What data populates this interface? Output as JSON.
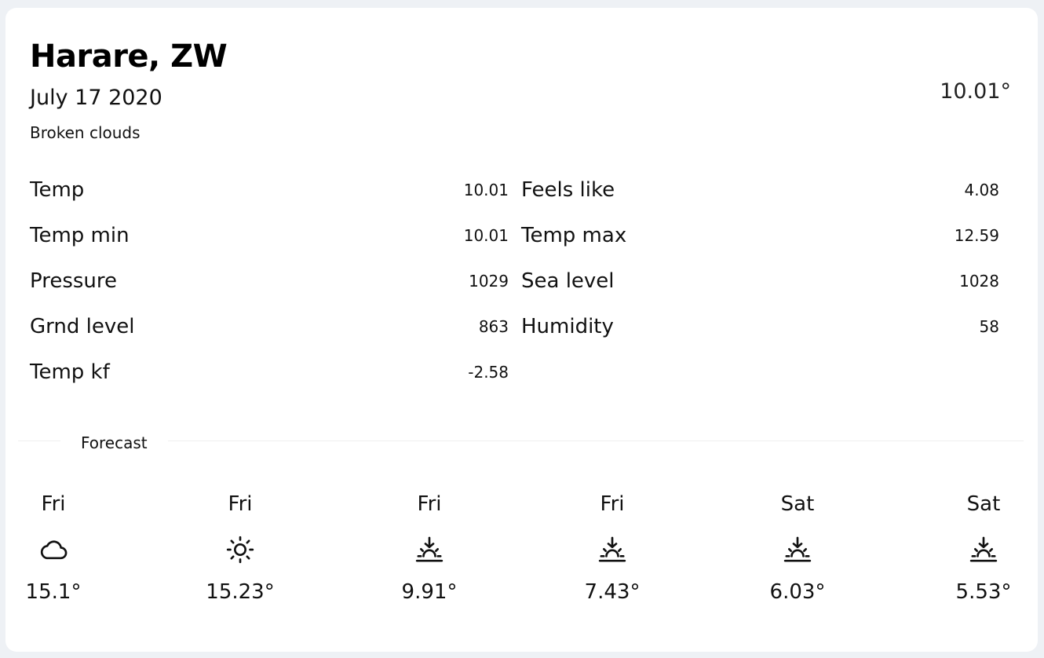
{
  "location": {
    "city": "Harare, ZW",
    "date": "July 17 2020",
    "description": "Broken clouds",
    "current_temp": "10.01°"
  },
  "stats": {
    "left": [
      {
        "label": "Temp",
        "value": "10.01"
      },
      {
        "label": "Temp min",
        "value": "10.01"
      },
      {
        "label": "Pressure",
        "value": "1029"
      },
      {
        "label": "Grnd level",
        "value": "863"
      },
      {
        "label": "Temp kf",
        "value": "-2.58"
      }
    ],
    "right": [
      {
        "label": "Feels like",
        "value": "4.08"
      },
      {
        "label": "Temp max",
        "value": "12.59"
      },
      {
        "label": "Sea level",
        "value": "1028"
      },
      {
        "label": "Humidity",
        "value": "58"
      }
    ]
  },
  "forecast": {
    "title": "Forecast",
    "days": [
      {
        "day": "Fri",
        "icon": "cloud-icon",
        "temp": "15.1°"
      },
      {
        "day": "Fri",
        "icon": "sun-icon",
        "temp": "15.23°"
      },
      {
        "day": "Fri",
        "icon": "sunset-icon",
        "temp": "9.91°"
      },
      {
        "day": "Fri",
        "icon": "sunset-icon",
        "temp": "7.43°"
      },
      {
        "day": "Sat",
        "icon": "sunset-icon",
        "temp": "6.03°"
      },
      {
        "day": "Sat",
        "icon": "sunset-icon",
        "temp": "5.53°"
      }
    ]
  }
}
